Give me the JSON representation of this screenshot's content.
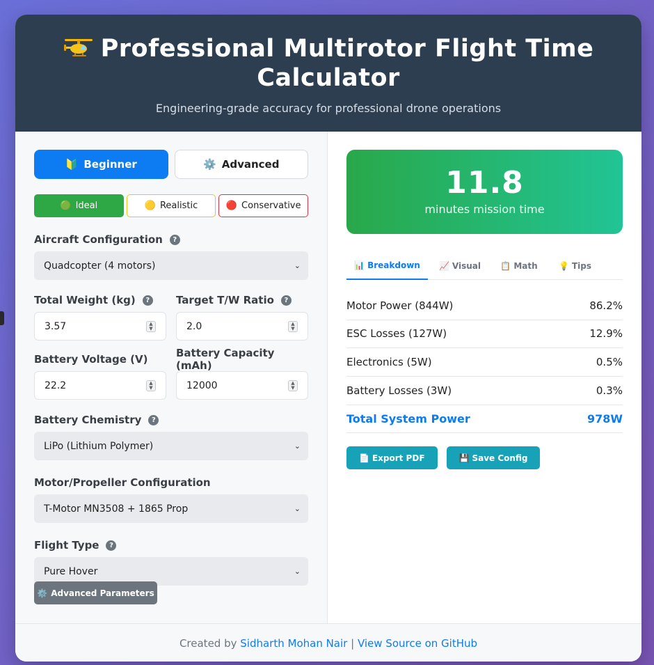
{
  "header": {
    "icon": "helicopter-icon",
    "title": "Professional Multirotor Flight Time Calculator",
    "subtitle": "Engineering-grade accuracy for professional drone operations"
  },
  "modes": [
    {
      "icon": "🔰",
      "label": "Beginner",
      "active": true
    },
    {
      "icon": "⚙️",
      "label": "Advanced",
      "active": false
    }
  ],
  "scenarios": [
    {
      "icon": "🟢",
      "label": "Ideal",
      "color": "#2ea745"
    },
    {
      "icon": "🟡",
      "label": "Realistic",
      "color": "#f2c21b"
    },
    {
      "icon": "🔴",
      "label": "Conservative",
      "color": "#d63545"
    }
  ],
  "form": {
    "aircraft_label": "Aircraft Configuration",
    "aircraft_value": "Quadcopter (4 motors)",
    "weight_label": "Total Weight (kg)",
    "weight_value": "3.57",
    "tw_label": "Target T/W Ratio",
    "tw_value": "2.0",
    "voltage_label": "Battery Voltage (V)",
    "voltage_value": "22.2",
    "capacity_label": "Battery Capacity (mAh)",
    "capacity_value": "12000",
    "chemistry_label": "Battery Chemistry",
    "chemistry_value": "LiPo (Lithium Polymer)",
    "motor_label": "Motor/Propeller Configuration",
    "motor_value": "T-Motor MN3508 + 1865 Prop",
    "flight_label": "Flight Type",
    "flight_value": "Pure Hover",
    "help_glyph": "?",
    "advanced_button": "Advanced Parameters",
    "advanced_icon": "⚙️"
  },
  "result": {
    "value": "11.8",
    "caption": "minutes mission time"
  },
  "tabs": [
    {
      "icon": "📊",
      "label": "Breakdown",
      "active": true
    },
    {
      "icon": "📈",
      "label": "Visual",
      "active": false
    },
    {
      "icon": "📋",
      "label": "Math",
      "active": false
    },
    {
      "icon": "💡",
      "label": "Tips",
      "active": false
    }
  ],
  "breakdown": [
    {
      "label": "Motor Power (844W)",
      "value": "86.2%"
    },
    {
      "label": "ESC Losses (127W)",
      "value": "12.9%"
    },
    {
      "label": "Electronics (5W)",
      "value": "0.5%"
    },
    {
      "label": "Battery Losses (3W)",
      "value": "0.3%"
    }
  ],
  "total": {
    "label": "Total System Power",
    "value": "978W"
  },
  "actions": [
    {
      "icon": "📄",
      "label": "Export PDF"
    },
    {
      "icon": "💾",
      "label": "Save Config"
    }
  ],
  "footer": {
    "prefix": "Created by ",
    "author": "Sidharth Mohan Nair",
    "separator": " | ",
    "link": "View Source on GitHub"
  },
  "colors": {
    "accent": "#0d7cf2",
    "header_bg": "#2d3e50",
    "result_start": "#29a84a",
    "result_end": "#21c495",
    "action": "#17a2b8"
  }
}
